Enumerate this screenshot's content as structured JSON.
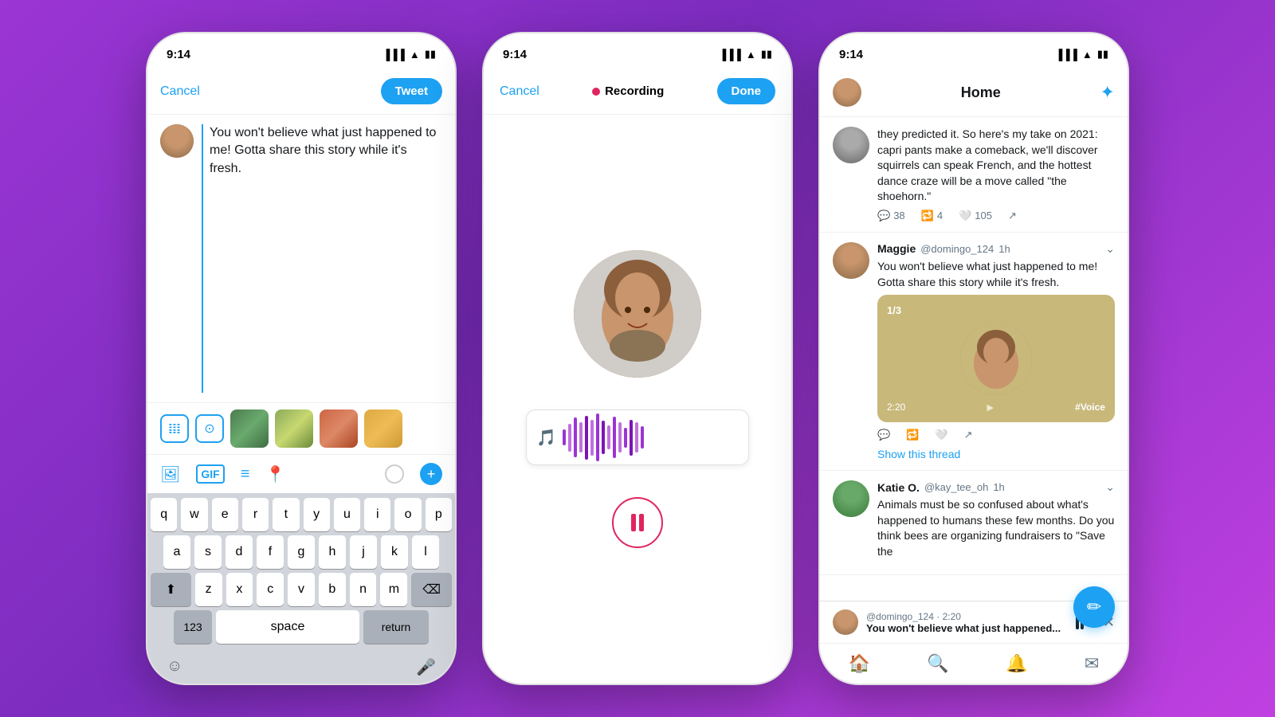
{
  "background": "#9b35d4",
  "phones": [
    {
      "id": "composer",
      "status": {
        "time": "9:14",
        "battery": "🔋",
        "signal": "▐▐▐",
        "wifi": "📶"
      },
      "header": {
        "cancel_label": "Cancel",
        "tweet_label": "Tweet"
      },
      "tweet_text": "You won't believe what just happened to me! Gotta share this story while it's fresh.",
      "toolbar": {
        "icons": [
          "🎵",
          "📷",
          "📋",
          "📍"
        ]
      },
      "keyboard": {
        "rows": [
          [
            "q",
            "w",
            "e",
            "r",
            "t",
            "y",
            "u",
            "i",
            "o",
            "p"
          ],
          [
            "a",
            "s",
            "d",
            "f",
            "g",
            "h",
            "j",
            "k",
            "l"
          ],
          [
            "⬆",
            "z",
            "x",
            "c",
            "v",
            "b",
            "n",
            "m",
            "⌫"
          ],
          [
            "123",
            "space",
            "return"
          ]
        ]
      }
    },
    {
      "id": "recording",
      "status": {
        "time": "9:14"
      },
      "header": {
        "cancel_label": "Cancel",
        "recording_label": "Recording",
        "done_label": "Done"
      },
      "waveform_bars": [
        20,
        35,
        50,
        38,
        55,
        45,
        60,
        42,
        30,
        52,
        38,
        25,
        45,
        38,
        28
      ]
    },
    {
      "id": "feed",
      "status": {
        "time": "9:14"
      },
      "header": {
        "title": "Home"
      },
      "tweets": [
        {
          "username": "",
          "handle": "",
          "time": "",
          "text": "they predicted it. So here's my take on 2021: capri pants make a comeback, we'll discover squirrels can speak French, and the hottest dance craze will be a move called \"the shoehorn.\"",
          "stats": {
            "replies": "38",
            "retweets": "4",
            "likes": "105"
          }
        },
        {
          "username": "Maggie",
          "handle": "@domingo_124",
          "time": "1h",
          "text": "You won't believe what just happened to me! Gotta share this story while it's fresh.",
          "has_voice": true,
          "voice_counter": "1/3",
          "voice_time": "2:20",
          "voice_hashtag": "#Voice",
          "show_thread": "Show this thread"
        },
        {
          "username": "Katie O.",
          "handle": "@kay_tee_oh",
          "time": "1h",
          "text": "Animals must be so confused about what's happened to humans these few months. Do you think bees are organizing fundraisers to \"Save the"
        }
      ],
      "mini_player": {
        "handle": "@domingo_124 · 2:20",
        "text": "You won't believe what just happened..."
      },
      "bottom_nav": {
        "icons": [
          "🏠",
          "🔍",
          "🔔",
          "✉"
        ]
      }
    }
  ]
}
